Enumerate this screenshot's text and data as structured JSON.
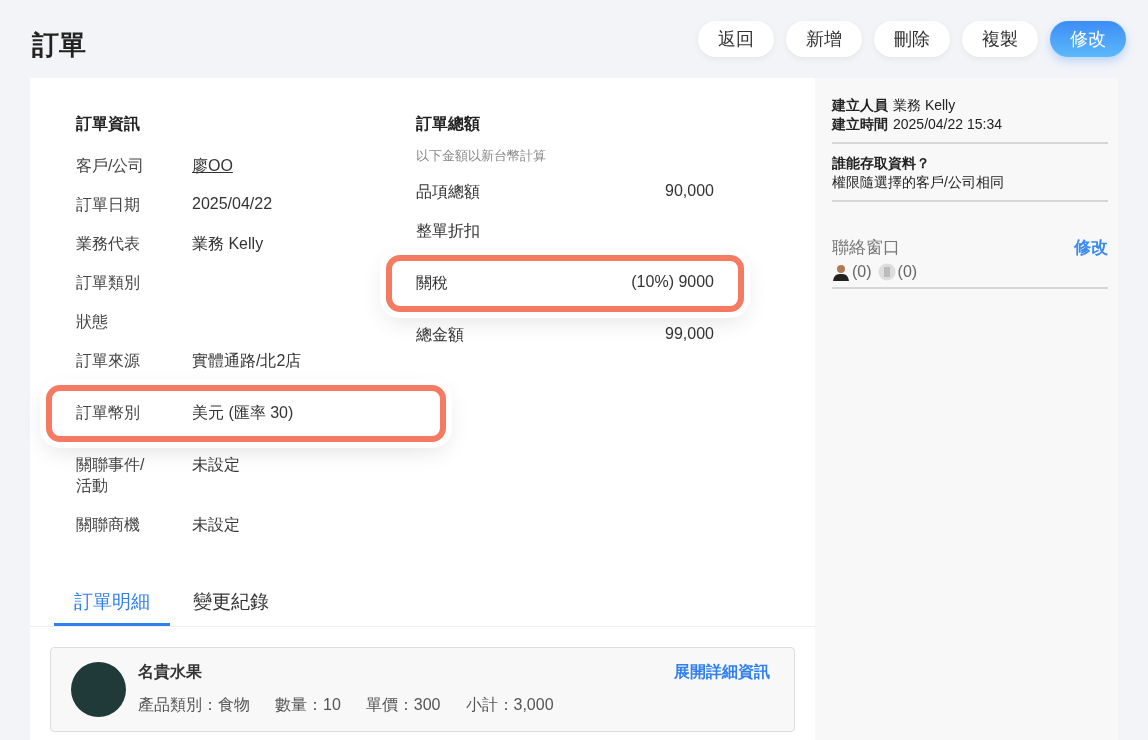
{
  "page_title": "訂單",
  "actions": [
    {
      "label": "返回",
      "primary": false
    },
    {
      "label": "新增",
      "primary": false
    },
    {
      "label": "刪除",
      "primary": false
    },
    {
      "label": "複製",
      "primary": false
    },
    {
      "label": "修改",
      "primary": true
    }
  ],
  "order_info": {
    "title": "訂單資訊",
    "rows": [
      {
        "label": "客戶/公司",
        "value": "廖OO",
        "kind": "link",
        "highlighted": false
      },
      {
        "label": "訂單日期",
        "value": "2025/04/22",
        "kind": "text",
        "highlighted": false
      },
      {
        "label": "業務代表",
        "value": "業務 Kelly",
        "kind": "text",
        "highlighted": false
      },
      {
        "label": "訂單類別",
        "highlighted": false
      },
      {
        "label": "狀態",
        "highlighted": false
      },
      {
        "label": "訂單來源",
        "value": "實體通路/北2店",
        "kind": "text",
        "highlighted": false
      },
      {
        "label": "訂單幣別",
        "value": "美元 (匯率 30)",
        "kind": "text",
        "highlighted": true
      },
      {
        "label": "關聯事件/活動",
        "value": "未設定",
        "kind": "text",
        "highlighted": false
      },
      {
        "label": "關聯商機",
        "value": "未設定",
        "kind": "text",
        "highlighted": false
      }
    ]
  },
  "order_total": {
    "title": "訂單總額",
    "note": "以下金額以新台幣計算",
    "rows": [
      {
        "label": "品項總額",
        "value": "90,000",
        "highlighted": false
      },
      {
        "label": "整單折扣",
        "highlighted": false
      },
      {
        "label": "關稅",
        "value": "(10%) 9000",
        "highlighted": true
      },
      {
        "label": "總金額",
        "value": "99,000",
        "highlighted": false
      }
    ]
  },
  "tabs": [
    {
      "label": "訂單明細",
      "selected": true
    },
    {
      "label": "變更紀錄",
      "selected": false
    }
  ],
  "items": [
    {
      "name": "名貴水果",
      "expand_link": "展開詳細資訊",
      "fields": [
        "產品類別：食物",
        "數量：10",
        "單價：300",
        "小計：3,000"
      ]
    }
  ],
  "sidebar": {
    "created_by_label": "建立人員",
    "created_by": "業務 Kelly",
    "created_at_label": "建立時間",
    "created_at": "2025/04/22 15:34",
    "access_title": "誰能存取資料？",
    "access_text": "權限隨選擇的客戶/公司相同",
    "contacts_title": "聯絡窗口",
    "contacts_edit": "修改",
    "person_count": "(0)",
    "company_count": "(0)"
  }
}
